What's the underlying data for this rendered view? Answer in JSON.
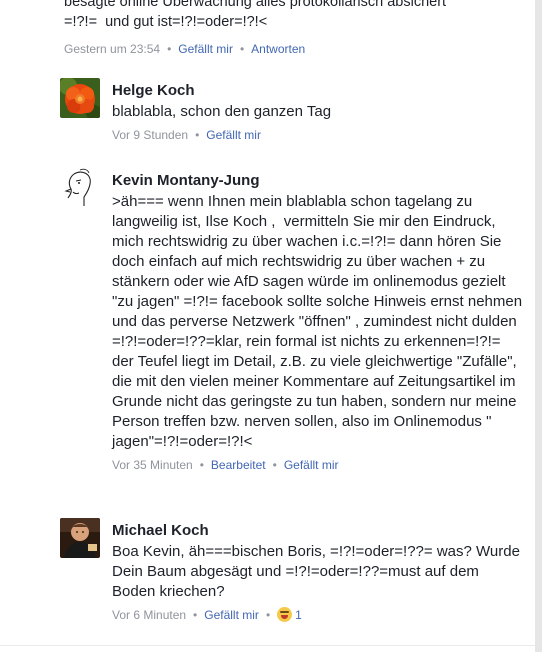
{
  "previous_comment": {
    "text": "besagte online Überwachung alles protokollarisch absichert\n=!?!=  und gut ist=!?!=oder=!?!<",
    "meta": {
      "time": "Gestern um 23:54",
      "like": "Gefällt mir",
      "reply": "Antworten"
    }
  },
  "comments": [
    {
      "author": "Helge Koch",
      "text": "blablabla, schon den ganzen Tag",
      "meta": {
        "time": "Vor 9 Stunden",
        "like": "Gefällt mir"
      }
    },
    {
      "author": "Kevin Montany-Jung",
      "text": ">äh=== wenn Ihnen mein blablabla schon tagelang zu langweilig ist, Ilse Koch ,  vermitteln Sie mir den Eindruck, mich rechtswidrig zu über wachen i.c.=!?!= dann hören Sie doch einfach auf mich rechtswidrig zu über wachen + zu stänkern oder wie AfD sagen würde im onlinemodus gezielt \"zu jagen\" =!?!= facebook sollte solche Hinweis ernst nehmen und das perverse Netzwerk \"öffnen\" , zumindest nicht dulden =!?!=oder=!??=klar, rein formal ist nichts zu erkennen=!?!= der Teufel liegt im Detail, z.B. zu viele gleichwertige \"Zufälle\", die mit den vielen meiner Kommentare auf Zeitungsartikel im Grunde nicht das geringste zu tun haben, sondern nur meine Person treffen bzw. nerven sollen, also im Onlinemodus \" jagen\"=!?!=oder=!?!<",
      "meta": {
        "time": "Vor 35 Minuten",
        "edited": "Bearbeitet",
        "like": "Gefällt mir"
      }
    },
    {
      "author": "Michael Koch",
      "text": "Boa Kevin, äh===bischen Boris, =!?!=oder=!??= was? Wurde Dein Baum abgesägt und =!?!=oder=!??=must auf dem Boden kriechen?",
      "meta": {
        "time": "Vor 6 Minuten",
        "like": "Gefällt mir",
        "reaction_icon": "laughing-emoji",
        "reaction_count": "1"
      }
    }
  ],
  "colors": {
    "text": "#1d2129",
    "meta": "#90949c",
    "link": "#4267b2",
    "reaction": "#f7c94a"
  }
}
